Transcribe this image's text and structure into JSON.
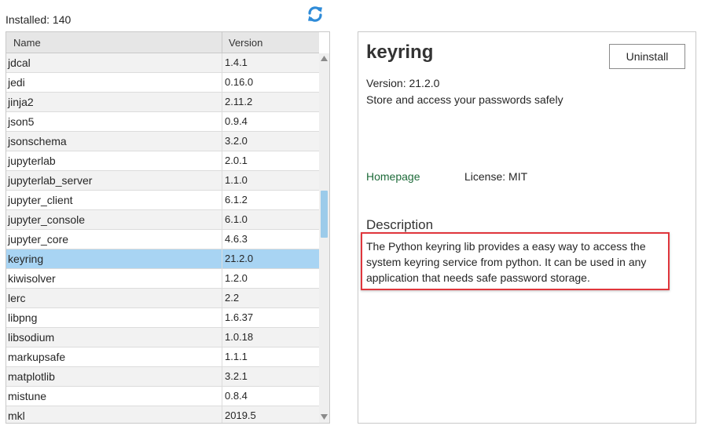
{
  "installed": {
    "count_label": "Installed: 140"
  },
  "icons": {
    "refresh": "refresh-icon",
    "scroll_up": "triangle-up-icon",
    "scroll_down": "triangle-down-icon"
  },
  "colors": {
    "accent": "#2e8bd8",
    "selected_row": "#a8d4f3",
    "link": "#1e6b3a",
    "highlight_border": "#e0363c"
  },
  "table": {
    "columns": [
      "Name",
      "Version"
    ],
    "rows": [
      {
        "name": "jdcal",
        "version": "1.4.1"
      },
      {
        "name": "jedi",
        "version": "0.16.0"
      },
      {
        "name": "jinja2",
        "version": "2.11.2"
      },
      {
        "name": "json5",
        "version": "0.9.4"
      },
      {
        "name": "jsonschema",
        "version": "3.2.0"
      },
      {
        "name": "jupyterlab",
        "version": "2.0.1"
      },
      {
        "name": "jupyterlab_server",
        "version": "1.1.0"
      },
      {
        "name": "jupyter_client",
        "version": "6.1.2"
      },
      {
        "name": "jupyter_console",
        "version": "6.1.0"
      },
      {
        "name": "jupyter_core",
        "version": "4.6.3"
      },
      {
        "name": "keyring",
        "version": "21.2.0",
        "selected": true
      },
      {
        "name": "kiwisolver",
        "version": "1.2.0"
      },
      {
        "name": "lerc",
        "version": "2.2"
      },
      {
        "name": "libpng",
        "version": "1.6.37"
      },
      {
        "name": "libsodium",
        "version": "1.0.18"
      },
      {
        "name": "markupsafe",
        "version": "1.1.1"
      },
      {
        "name": "matplotlib",
        "version": "3.2.1"
      },
      {
        "name": "mistune",
        "version": "0.8.4"
      },
      {
        "name": "mkl",
        "version": "2019.5"
      }
    ],
    "scroll_position": 0.42
  },
  "detail": {
    "name": "keyring",
    "uninstall_label": "Uninstall",
    "version_line": "Version: 21.2.0",
    "summary": "Store and access your passwords safely",
    "homepage_label": "Homepage",
    "license_line": "License: MIT",
    "description_heading": "Description",
    "description": "The Python keyring lib provides a easy way to access the system keyring service from python. It can be used in any application that needs safe password storage."
  }
}
